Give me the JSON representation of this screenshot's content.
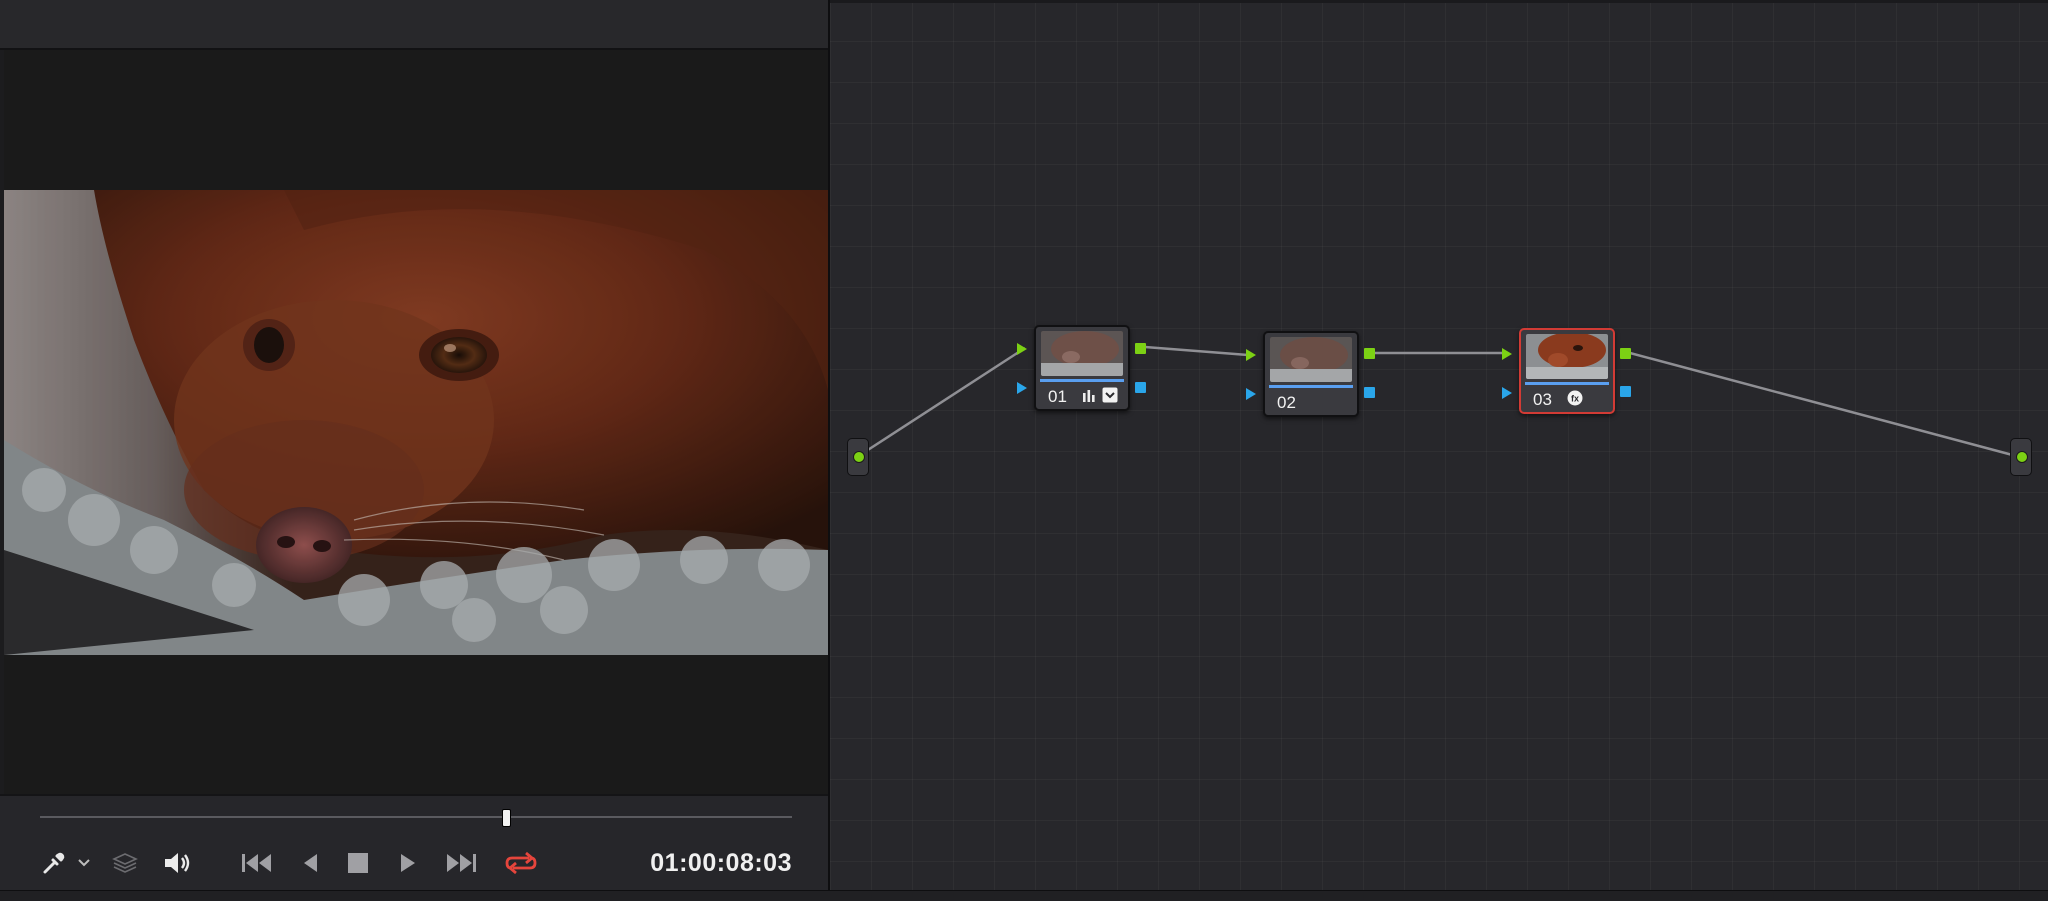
{
  "viewer": {
    "timecode": "01:00:08:03",
    "playhead_fraction": 0.62
  },
  "transport": {
    "icons": [
      "eyedropper-icon",
      "chevron-down-icon",
      "layers-icon",
      "speaker-icon",
      "skip-to-start-icon",
      "step-back-icon",
      "stop-icon",
      "play-icon",
      "skip-to-end-icon",
      "loop-icon"
    ]
  },
  "nodes": [
    {
      "label": "01",
      "icons": [
        "bars-icon",
        "checkbox-icon"
      ],
      "selected": false
    },
    {
      "label": "02",
      "icons": [],
      "selected": false
    },
    {
      "label": "03",
      "icons": [
        "fx-icon"
      ],
      "selected": true
    }
  ],
  "colors": {
    "accent_red": "#e5453c",
    "port_green": "#7cd114",
    "port_blue": "#2aa6ea",
    "selected_border": "#d23b35"
  }
}
